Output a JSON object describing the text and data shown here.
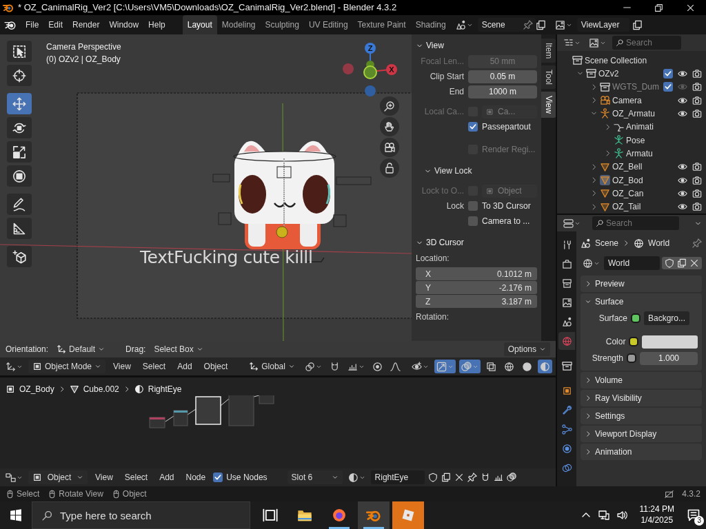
{
  "window": {
    "title": "* OZ_CanimalRig_Ver2 [C:\\Users\\VM5\\Downloads\\OZ_CanimalRig_Ver2.blend] - Blender 4.3.2"
  },
  "menu": [
    "File",
    "Edit",
    "Render",
    "Window",
    "Help"
  ],
  "workspaces": [
    {
      "label": "Layout",
      "selected": true
    },
    {
      "label": "Modeling",
      "selected": false
    },
    {
      "label": "Sculpting",
      "selected": false
    },
    {
      "label": "UV Editing",
      "selected": false
    },
    {
      "label": "Texture Paint",
      "selected": false
    },
    {
      "label": "Shading",
      "selected": false
    }
  ],
  "scene": "Scene",
  "view_layer": "ViewLayer",
  "viewport": {
    "view_name": "Camera Perspective",
    "context": "(0) OZv2 | OZ_Body",
    "scene_text": "TextFucking cute killl",
    "gizmo": [
      "Z",
      "X"
    ],
    "tools": [
      {
        "kind": "select",
        "selected": false
      },
      {
        "kind": "cursor",
        "selected": false
      },
      {
        "kind": "move",
        "selected": true
      },
      {
        "kind": "rotate",
        "selected": false
      },
      {
        "kind": "scale",
        "selected": false
      },
      {
        "kind": "transform",
        "selected": false
      },
      {
        "kind": "annotate",
        "selected": false
      },
      {
        "kind": "measure",
        "selected": false
      },
      {
        "kind": "add_cube",
        "selected": false
      }
    ],
    "tool_settings": {
      "orientation_label": "Orientation:",
      "orientation": "Default",
      "drag_label": "Drag:",
      "drag": "Select Box",
      "options": "Options"
    },
    "header": {
      "mode": "Object Mode",
      "menus": [
        "View",
        "Select",
        "Add",
        "Object"
      ],
      "orientation": "Global"
    }
  },
  "sidebar": {
    "tabs": [
      {
        "label": "Item",
        "selected": false
      },
      {
        "label": "Tool",
        "selected": false
      },
      {
        "label": "View",
        "selected": true
      }
    ],
    "panels": [
      {
        "title": "View",
        "expanded": true,
        "rows": [
          {
            "kind": "field",
            "label": "Focal Len...",
            "value": "50 mm",
            "disabled": true
          },
          {
            "kind": "field",
            "label": "Clip Start",
            "value": "0.05 m",
            "disabled": false
          },
          {
            "kind": "field",
            "label": "End",
            "value": "1000 m",
            "disabled": false
          },
          {
            "kind": "checkfield",
            "label": "Local Ca...",
            "value": "Ca...",
            "checked": false,
            "disabled": true
          },
          {
            "kind": "check",
            "text": "Passepartout",
            "checked": true,
            "disabled": false
          },
          {
            "kind": "check",
            "text": "Render Regi...",
            "checked": false,
            "disabled": true
          },
          {
            "kind": "subheader",
            "text": "View Lock",
            "expanded": true
          },
          {
            "kind": "checkfield",
            "label": "Lock to O...",
            "value": "Object",
            "checked": false,
            "disabled": true
          },
          {
            "kind": "check",
            "label": "Lock",
            "text": "To 3D Cursor",
            "checked": false,
            "disabled": false
          },
          {
            "kind": "check",
            "text": "Camera to ...",
            "checked": false,
            "disabled": false
          }
        ]
      },
      {
        "title": "3D Cursor",
        "expanded": true,
        "rows": [
          {
            "kind": "caption",
            "text": "Location:"
          },
          {
            "kind": "vector",
            "items": [
              {
                "axis": "X",
                "value": "0.1012 m"
              },
              {
                "axis": "Y",
                "value": "-2.176 m"
              },
              {
                "axis": "Z",
                "value": "3.187 m"
              }
            ]
          },
          {
            "kind": "caption",
            "text": "Rotation:"
          }
        ]
      }
    ]
  },
  "outliner": {
    "search": {
      "placeholder": "Search"
    },
    "tree": [
      {
        "kind": "scene_collection",
        "label": "Scene Collection",
        "selected": false,
        "children": [
          {
            "kind": "collection",
            "label": "OZv2",
            "expanded": true,
            "include": true,
            "visible": true,
            "selected": false,
            "children": [
              {
                "kind": "collection",
                "label": "WGTS_Dum",
                "expanded": false,
                "include": true,
                "visible": false,
                "selected": false
              },
              {
                "kind": "camera",
                "label": "Camera",
                "expanded": false,
                "visible": true,
                "selected": false
              },
              {
                "kind": "armature",
                "label": "OZ_Armatu",
                "expanded": true,
                "visible": true,
                "selected": false,
                "children": [
                  {
                    "kind": "action",
                    "label": "Animati",
                    "expanded": false,
                    "selected": false
                  },
                  {
                    "kind": "pose",
                    "label": "Pose",
                    "selected": false
                  },
                  {
                    "kind": "armature_data",
                    "label": "Armatu",
                    "expanded": false,
                    "selected": false
                  }
                ]
              },
              {
                "kind": "mesh",
                "label": "OZ_Bell",
                "expanded": false,
                "visible": true,
                "selected": false
              },
              {
                "kind": "mesh",
                "label": "OZ_Bod",
                "expanded": false,
                "visible": true,
                "selected": true
              },
              {
                "kind": "mesh",
                "label": "OZ_Can",
                "expanded": false,
                "visible": true,
                "selected": false
              },
              {
                "kind": "mesh",
                "label": "OZ_Tail",
                "expanded": false,
                "visible": true,
                "selected": false
              }
            ]
          }
        ]
      }
    ]
  },
  "properties": {
    "search": {
      "placeholder": "Search"
    },
    "tabs": [
      {
        "kind": "tool",
        "selected": false
      },
      {
        "kind": "render",
        "selected": false
      },
      {
        "kind": "output",
        "selected": false
      },
      {
        "kind": "view_layer",
        "selected": false
      },
      {
        "kind": "scene",
        "selected": false
      },
      {
        "kind": "world",
        "selected": true
      },
      {
        "kind": "collection",
        "selected": false
      },
      {
        "kind": "object",
        "selected": false
      },
      {
        "kind": "modifiers",
        "selected": false
      },
      {
        "kind": "particles",
        "selected": false
      },
      {
        "kind": "physics",
        "selected": false
      },
      {
        "kind": "constraints",
        "selected": false
      }
    ],
    "breadcrumb": [
      "Scene",
      "World"
    ],
    "datablock": "World",
    "panels": [
      {
        "title": "Preview",
        "expanded": false
      },
      {
        "title": "Surface",
        "expanded": true,
        "rows": [
          {
            "kind": "link",
            "label": "Surface",
            "value": "Backgro...",
            "color": "#5fc55f"
          },
          {
            "kind": "swatch",
            "label": "Color",
            "color": "#c8c82a"
          },
          {
            "kind": "number",
            "label": "Strength",
            "color": "#9a9a9a",
            "value": "1.000"
          }
        ]
      },
      {
        "title": "Volume",
        "expanded": false
      },
      {
        "title": "Ray Visibility",
        "expanded": false
      },
      {
        "title": "Settings",
        "expanded": false
      },
      {
        "title": "Viewport Display",
        "expanded": false
      },
      {
        "title": "Animation",
        "expanded": false
      }
    ]
  },
  "node_editor": {
    "breadcrumb": [
      {
        "kind": "object",
        "label": "OZ_Body"
      },
      {
        "kind": "mesh",
        "label": "Cube.002"
      },
      {
        "kind": "material",
        "label": "RightEye"
      }
    ],
    "header": {
      "type": "Object",
      "menus": [
        "View",
        "Select",
        "Add",
        "Node"
      ],
      "use_nodes": {
        "label": "Use Nodes",
        "checked": true
      },
      "slot": "Slot 6",
      "material": "RightEye"
    }
  },
  "status_bar": {
    "hints": [
      "Select",
      "Rotate View",
      "Object"
    ],
    "version": "4.3.2"
  },
  "taskbar": {
    "search": {
      "placeholder": "Type here to search"
    },
    "apps": [
      {
        "kind": "task_view",
        "running": false,
        "active": false,
        "flashing": false
      },
      {
        "kind": "explorer",
        "running": false,
        "active": false,
        "flashing": false
      },
      {
        "kind": "firefox",
        "running": true,
        "active": false,
        "flashing": false
      },
      {
        "kind": "blender",
        "running": true,
        "active": true,
        "flashing": false
      },
      {
        "kind": "roblox",
        "running": false,
        "active": false,
        "flashing": true
      }
    ],
    "time": "11:24 PM",
    "date": "1/4/2025",
    "notifications": "3"
  }
}
